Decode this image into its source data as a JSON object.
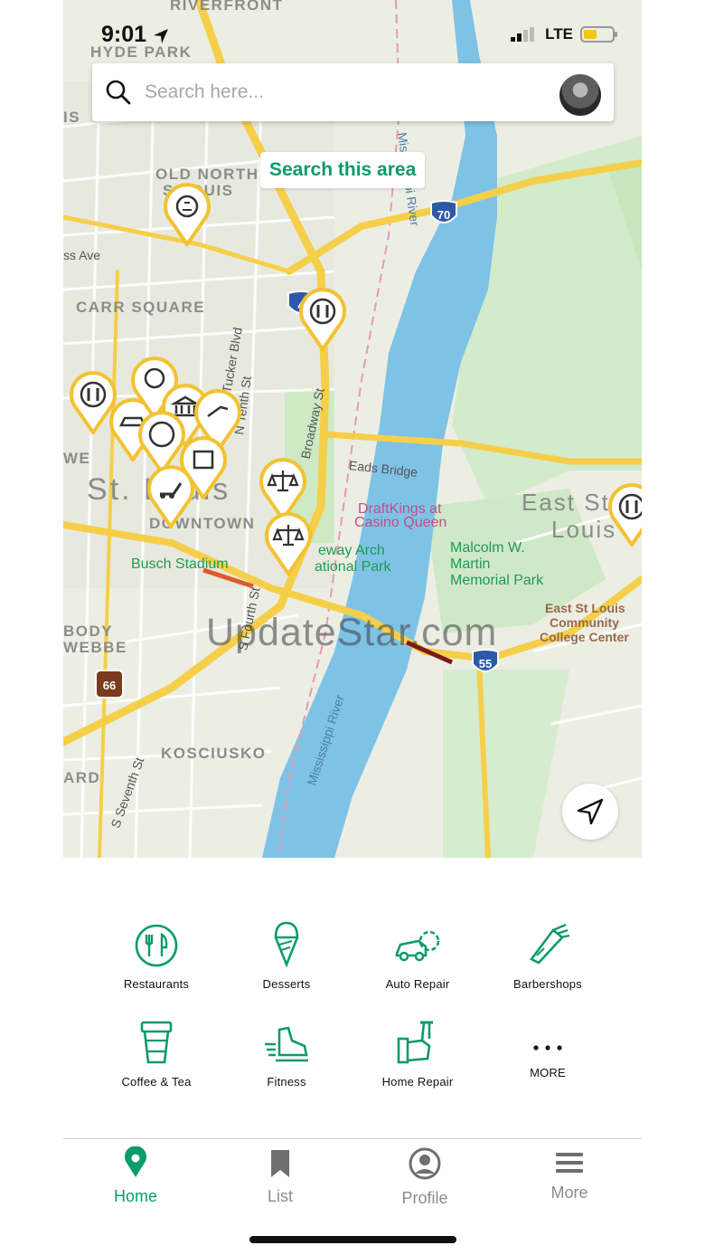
{
  "status_bar": {
    "time": "9:01",
    "network": "LTE"
  },
  "search": {
    "placeholder": "Search here..."
  },
  "search_area_button": "Search this area",
  "map": {
    "area_labels": [
      "RIVERFRONT",
      "HYDE PARK",
      "OLD NORTH",
      "S LOUIS",
      "CARR SQUARE",
      "DOWNTOWN",
      "KOSCIUSKO",
      "BODY",
      "WEBBE",
      "ARD",
      "IS",
      "WE"
    ],
    "city_labels": [
      "St. Louis",
      "East St.",
      "Louis"
    ],
    "street_labels": [
      "ss Ave",
      "Tucker Blvd",
      "N Tenth St",
      "Broadway St",
      "Eads Bridge",
      "S Fourth St",
      "S Seventh St",
      "Mississippi River",
      "Mississippi River"
    ],
    "poi_labels": [
      "Busch Stadium",
      "DraftKings at",
      "Casino Queen",
      "Malcolm W.",
      "Martin",
      "Memorial Park",
      "East St Louis",
      "Community",
      "College Center",
      "eway Arch",
      "ational Park"
    ],
    "highway_shields": [
      "70",
      "55",
      "66",
      "4"
    ],
    "watermark": "UpdateStar.com"
  },
  "categories": [
    {
      "label": "Restaurants",
      "icon": "utensils-icon"
    },
    {
      "label": "Desserts",
      "icon": "ice-cream-icon"
    },
    {
      "label": "Auto Repair",
      "icon": "car-wrench-icon"
    },
    {
      "label": "Barbershops",
      "icon": "clipper-icon"
    },
    {
      "label": "Coffee & Tea",
      "icon": "coffee-cup-icon"
    },
    {
      "label": "Fitness",
      "icon": "running-shoe-icon"
    },
    {
      "label": "Home Repair",
      "icon": "tool-icon"
    },
    {
      "label": "MORE",
      "icon": "more-dots-icon"
    }
  ],
  "tabs": [
    {
      "label": "Home",
      "icon": "map-pin-icon",
      "active": true
    },
    {
      "label": "List",
      "icon": "bookmark-icon",
      "active": false
    },
    {
      "label": "Profile",
      "icon": "person-circle-icon",
      "active": false
    },
    {
      "label": "More",
      "icon": "hamburger-icon",
      "active": false
    }
  ],
  "colors": {
    "accent": "#0c9b6a",
    "pin": "#f2c230",
    "road": "#f5cf4a",
    "river": "#7ec3e6",
    "park": "#cdeac5",
    "inactive": "#8c8c8c"
  }
}
